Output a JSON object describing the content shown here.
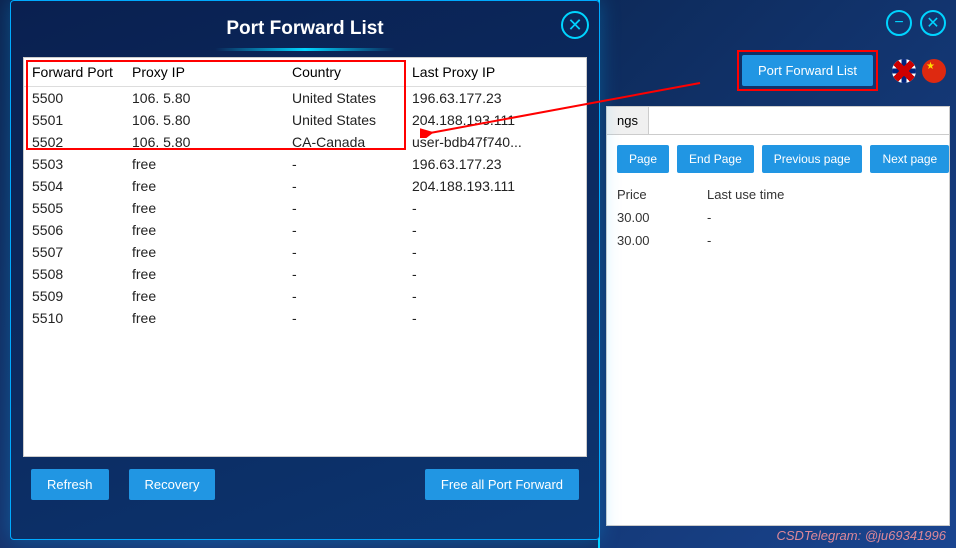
{
  "modal": {
    "title": "Port Forward List",
    "columns": [
      "Forward Port",
      "Proxy IP",
      "Country",
      "Last Proxy IP"
    ],
    "rows": [
      {
        "port": "5500",
        "proxy": "106.      5.80",
        "country": "United States",
        "last": "196.63.177.23"
      },
      {
        "port": "5501",
        "proxy": "106.      5.80",
        "country": "United States",
        "last": "204.188.193.111"
      },
      {
        "port": "5502",
        "proxy": "106.      5.80",
        "country": "CA-Canada",
        "last": "user-bdb47f740..."
      },
      {
        "port": "5503",
        "proxy": "free",
        "country": "-",
        "last": "196.63.177.23"
      },
      {
        "port": "5504",
        "proxy": "free",
        "country": "-",
        "last": "204.188.193.111"
      },
      {
        "port": "5505",
        "proxy": "free",
        "country": "-",
        "last": "-"
      },
      {
        "port": "5506",
        "proxy": "free",
        "country": "-",
        "last": "-"
      },
      {
        "port": "5507",
        "proxy": "free",
        "country": "-",
        "last": "-"
      },
      {
        "port": "5508",
        "proxy": "free",
        "country": "-",
        "last": "-"
      },
      {
        "port": "5509",
        "proxy": "free",
        "country": "-",
        "last": "-"
      },
      {
        "port": "5510",
        "proxy": "free",
        "country": "-",
        "last": "-"
      }
    ],
    "buttons": {
      "refresh": "Refresh",
      "recovery": "Recovery",
      "freeall": "Free all Port Forward"
    }
  },
  "right": {
    "pfl_btn": "Port Forward List",
    "tab": "ngs",
    "nav": {
      "page": "Page",
      "end": "End Page",
      "prev": "Previous page",
      "next": "Next page"
    },
    "cols": {
      "price": "Price",
      "time": "Last use time"
    },
    "rows": [
      {
        "price": "30.00",
        "time": "-"
      },
      {
        "price": "30.00",
        "time": "-"
      }
    ]
  },
  "footer": "CSDTelegram: @ju69341996"
}
